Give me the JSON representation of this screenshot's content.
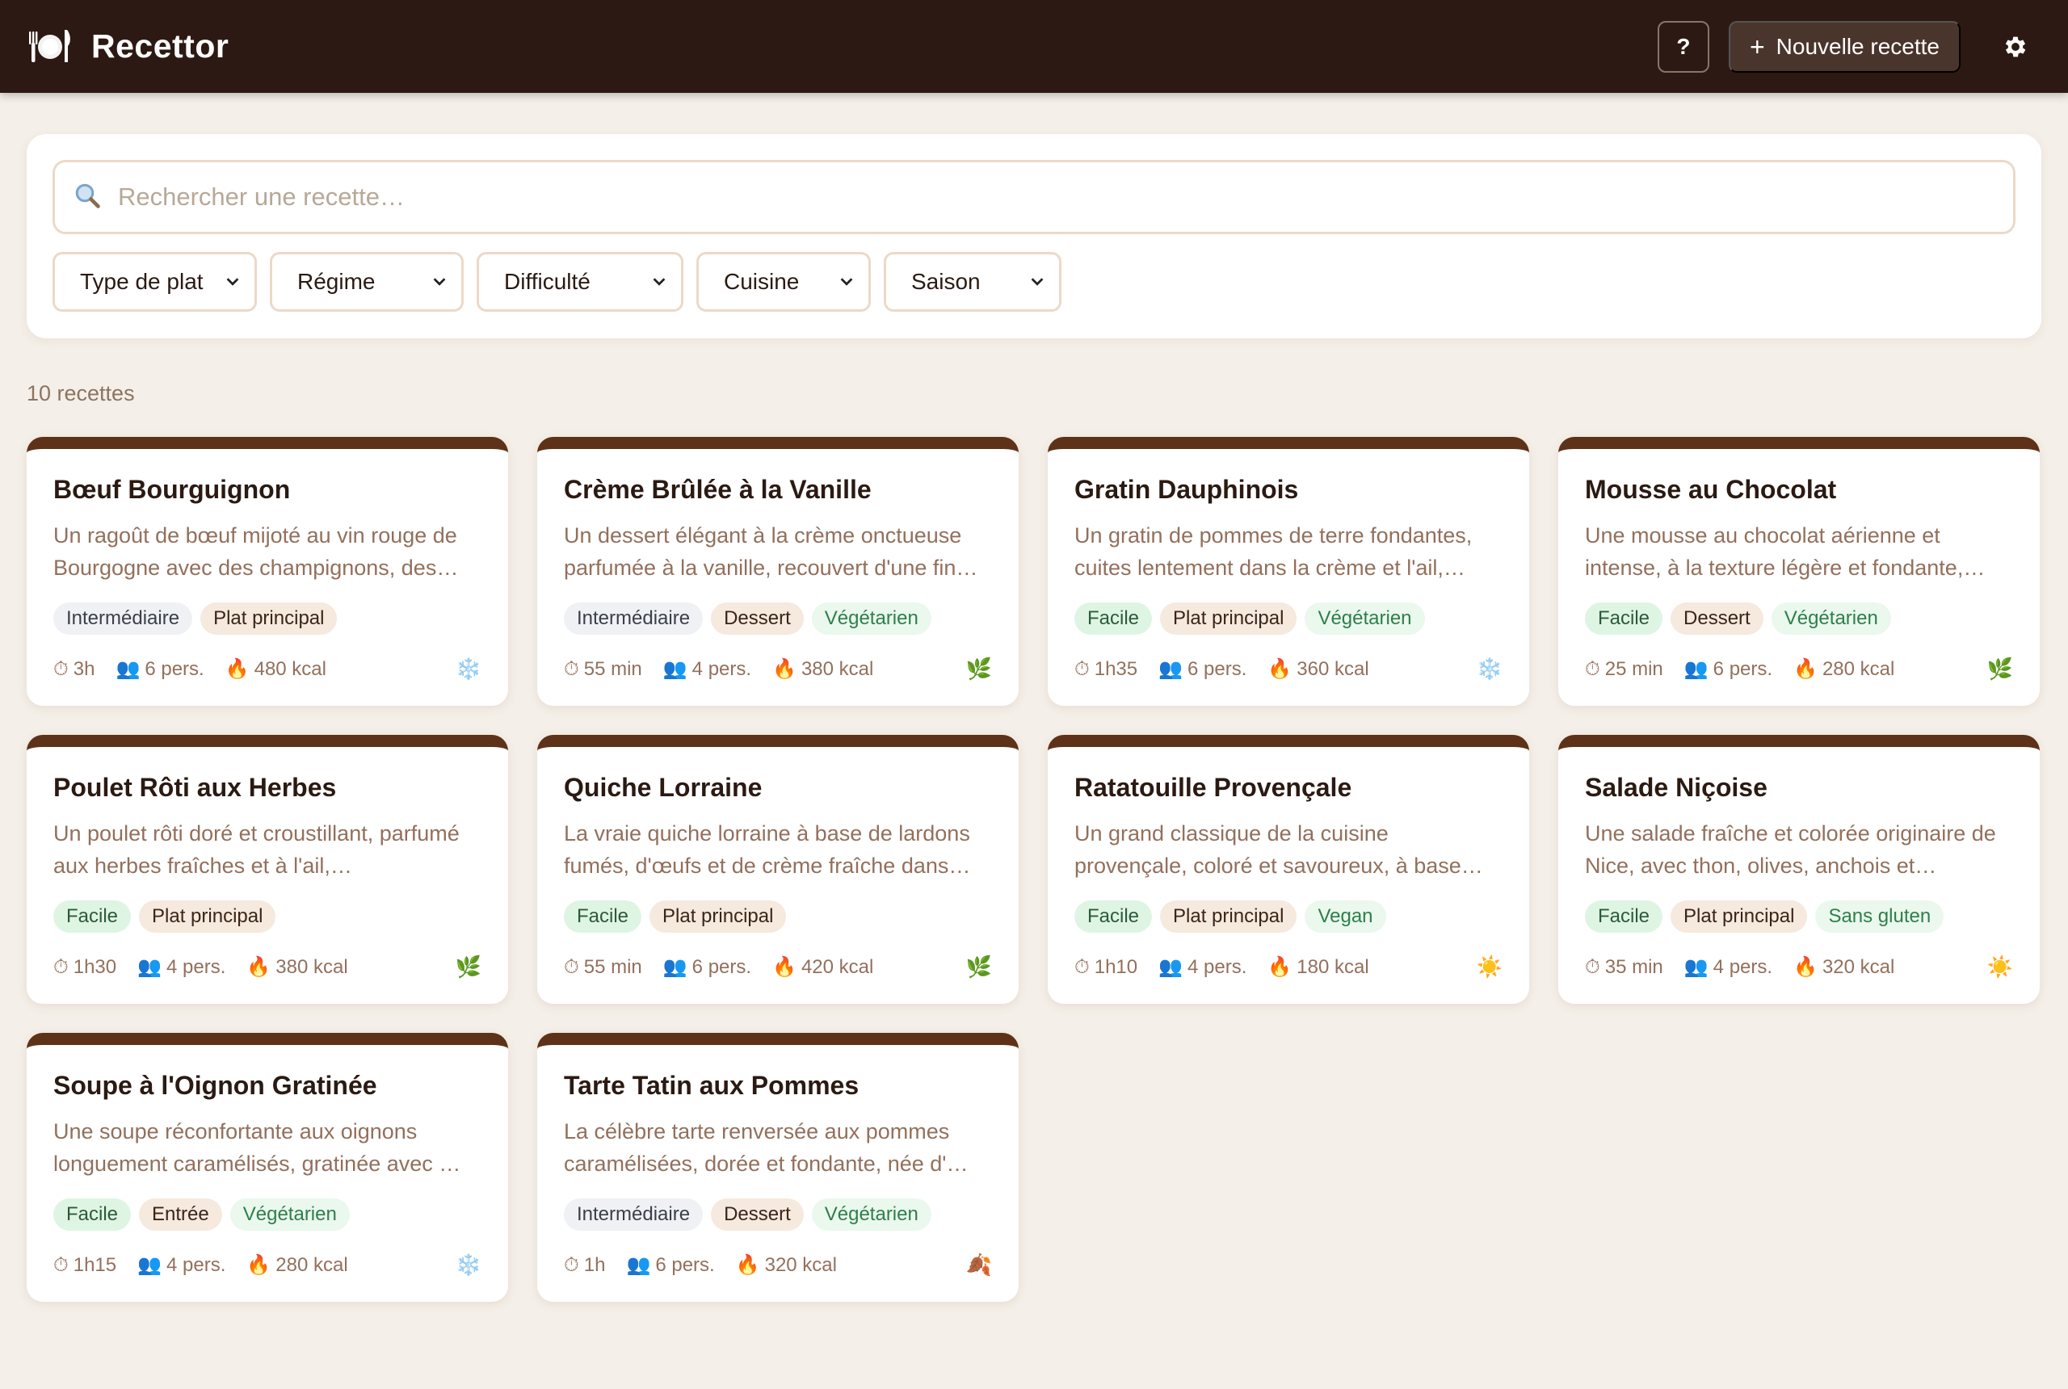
{
  "app": {
    "title": "Recettor",
    "help_label": "?",
    "new_recipe_plus": "+",
    "new_recipe_label": "Nouvelle recette"
  },
  "search": {
    "placeholder": "Rechercher une recette…"
  },
  "filters": [
    {
      "label": "Type de plat",
      "chevron": "⌄"
    },
    {
      "label": "Régime",
      "chevron": "⌄"
    },
    {
      "label": "Difficulté",
      "chevron": "⌄"
    },
    {
      "label": "Cuisine",
      "chevron": "⌄"
    },
    {
      "label": "Saison",
      "chevron": "⌄"
    }
  ],
  "results_count": "10 recettes",
  "icons": {
    "time": "⏱",
    "people": "👥",
    "calories": "🔥"
  },
  "recipes": [
    {
      "title": "Bœuf Bourguignon",
      "description": "Un ragoût de bœuf mijoté au vin rouge de Bourgogne avec des champignons, des…",
      "level": "Intermédiaire",
      "level_kind": "int",
      "type": "Plat principal",
      "diet": "",
      "time": "3h",
      "servings": "6 pers.",
      "calories": "480 kcal",
      "season_icon": "❄️",
      "season_name": "snowflake-icon"
    },
    {
      "title": "Crème Brûlée à la Vanille",
      "description": "Un dessert élégant à la crème onctueuse parfumée à la vanille, recouvert d'une fin…",
      "level": "Intermédiaire",
      "level_kind": "int",
      "type": "Dessert",
      "diet": "Végétarien",
      "time": "55 min",
      "servings": "4 pers.",
      "calories": "380 kcal",
      "season_icon": "🌿",
      "season_name": "leaf-icon"
    },
    {
      "title": "Gratin Dauphinois",
      "description": "Un gratin de pommes de terre fondantes, cuites lentement dans la crème et l'ail,…",
      "level": "Facile",
      "level_kind": "easy",
      "type": "Plat principal",
      "diet": "Végétarien",
      "time": "1h35",
      "servings": "6 pers.",
      "calories": "360 kcal",
      "season_icon": "❄️",
      "season_name": "snowflake-icon"
    },
    {
      "title": "Mousse au Chocolat",
      "description": "Une mousse au chocolat aérienne et intense, à la texture légère et fondante,…",
      "level": "Facile",
      "level_kind": "easy",
      "type": "Dessert",
      "diet": "Végétarien",
      "time": "25 min",
      "servings": "6 pers.",
      "calories": "280 kcal",
      "season_icon": "🌿",
      "season_name": "leaf-icon"
    },
    {
      "title": "Poulet Rôti aux Herbes",
      "description": "Un poulet rôti doré et croustillant, parfumé aux herbes fraîches et à l'ail,…",
      "level": "Facile",
      "level_kind": "easy",
      "type": "Plat principal",
      "diet": "",
      "time": "1h30",
      "servings": "4 pers.",
      "calories": "380 kcal",
      "season_icon": "🌿",
      "season_name": "leaf-icon"
    },
    {
      "title": "Quiche Lorraine",
      "description": "La vraie quiche lorraine à base de lardons fumés, d'œufs et de crème fraîche dans…",
      "level": "Facile",
      "level_kind": "easy",
      "type": "Plat principal",
      "diet": "",
      "time": "55 min",
      "servings": "6 pers.",
      "calories": "420 kcal",
      "season_icon": "🌿",
      "season_name": "leaf-icon"
    },
    {
      "title": "Ratatouille Provençale",
      "description": "Un grand classique de la cuisine provençale, coloré et savoureux, à base…",
      "level": "Facile",
      "level_kind": "easy",
      "type": "Plat principal",
      "diet": "Vegan",
      "time": "1h10",
      "servings": "4 pers.",
      "calories": "180 kcal",
      "season_icon": "☀️",
      "season_name": "sun-icon"
    },
    {
      "title": "Salade Niçoise",
      "description": "Une salade fraîche et colorée originaire de Nice, avec thon, olives, anchois et…",
      "level": "Facile",
      "level_kind": "easy",
      "type": "Plat principal",
      "diet": "Sans gluten",
      "time": "35 min",
      "servings": "4 pers.",
      "calories": "320 kcal",
      "season_icon": "☀️",
      "season_name": "sun-icon"
    },
    {
      "title": "Soupe à l'Oignon Gratinée",
      "description": "Une soupe réconfortante aux oignons longuement caramélisés, gratinée avec …",
      "level": "Facile",
      "level_kind": "easy",
      "type": "Entrée",
      "diet": "Végétarien",
      "time": "1h15",
      "servings": "4 pers.",
      "calories": "280 kcal",
      "season_icon": "❄️",
      "season_name": "snowflake-icon"
    },
    {
      "title": "Tarte Tatin aux Pommes",
      "description": "La célèbre tarte renversée aux pommes caramélisées, dorée et fondante, née d'…",
      "level": "Intermédiaire",
      "level_kind": "int",
      "type": "Dessert",
      "diet": "Végétarien",
      "time": "1h",
      "servings": "6 pers.",
      "calories": "320 kcal",
      "season_icon": "🍂",
      "season_name": "autumn-leaf-icon"
    }
  ]
}
